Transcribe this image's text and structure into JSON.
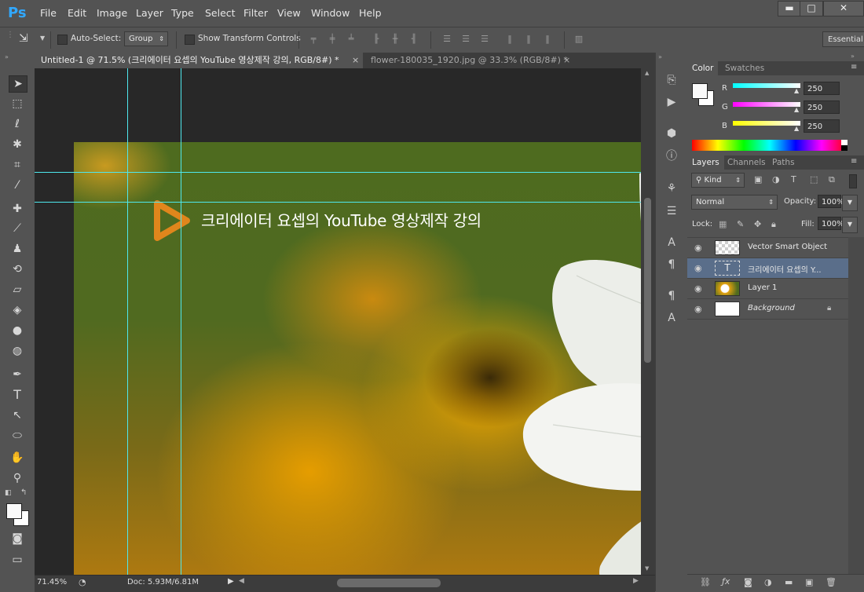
{
  "app": {
    "logo": "Ps",
    "workspace_label": "Essential"
  },
  "menu": [
    "File",
    "Edit",
    "Image",
    "Layer",
    "Type",
    "Select",
    "Filter",
    "View",
    "Window",
    "Help"
  ],
  "window_controls": {
    "minimize": "▬",
    "restore": "□",
    "close": "✕"
  },
  "options_bar": {
    "auto_select_label": "Auto-Select:",
    "auto_select_value": "Group",
    "transform_label": "Show Transform Controls"
  },
  "tabs": [
    {
      "label": "Untitled-1 @ 71.5% (크리에이터 요셉의 YouTube 영상제작 강의, RGB/8#) *",
      "close": "×"
    },
    {
      "label": "flower-180035_1920.jpg @ 33.3% (RGB/8#) *",
      "close": "×"
    }
  ],
  "canvas": {
    "headline": "크리에이터 요셉의 YouTube 영상제작 강의"
  },
  "status": {
    "zoom": "71.45%",
    "doc": "Doc: 5.93M/6.81M"
  },
  "color_panel": {
    "tabs": [
      "Color",
      "Swatches"
    ],
    "channels": [
      {
        "label": "R",
        "value": "250"
      },
      {
        "label": "G",
        "value": "250"
      },
      {
        "label": "B",
        "value": "250"
      }
    ]
  },
  "layers_panel": {
    "tabs": [
      "Layers",
      "Channels",
      "Paths"
    ],
    "kind_label": "Kind",
    "blend_mode": "Normal",
    "opacity_label": "Opacity:",
    "opacity_value": "100%",
    "lock_label": "Lock:",
    "fill_label": "Fill:",
    "fill_value": "100%",
    "layers": [
      {
        "name": "Vector Smart Object"
      },
      {
        "name": "크리에이터 요셉의 Y..."
      },
      {
        "name": "Layer 1"
      },
      {
        "name": "Background"
      }
    ]
  },
  "colors": {
    "guide": "#4ee8ee",
    "accent_orange": "#f08a1c",
    "selected_layer": "#5a6e8a"
  }
}
